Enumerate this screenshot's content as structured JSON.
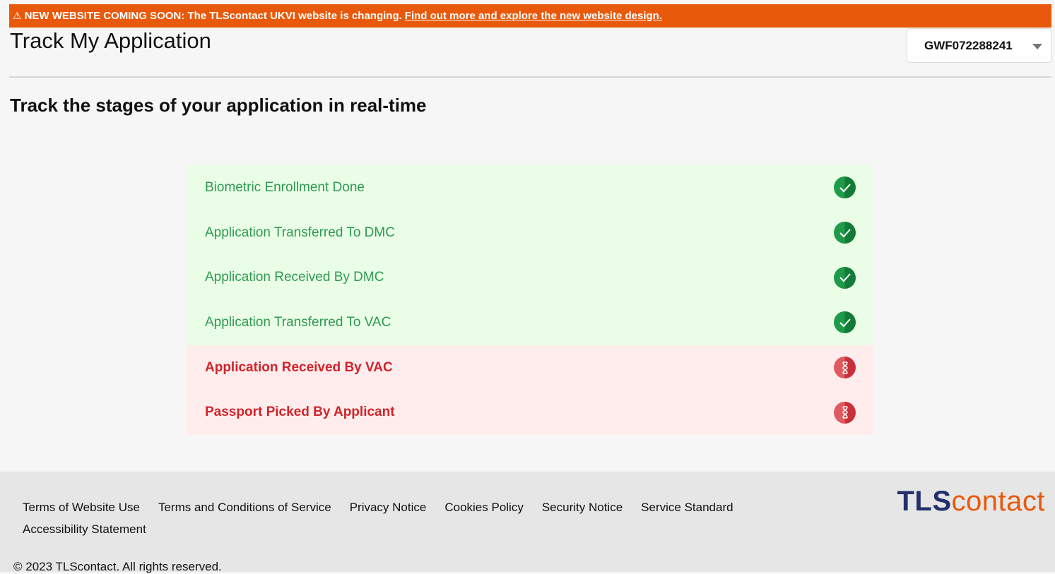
{
  "banner": {
    "headline": "NEW WEBSITE COMING SOON:",
    "message": "The TLScontact UKVI website is changing.",
    "link_text": "Find out more and explore the new website design."
  },
  "header": {
    "title": "Track My Application",
    "application_select": {
      "value": "GWF072288241"
    }
  },
  "main": {
    "subtitle": "Track the stages of your application in real-time",
    "stages": [
      {
        "label": "Biometric Enrollment Done",
        "status": "done",
        "icon": "check-circle-icon"
      },
      {
        "label": "Application Transferred To DMC",
        "status": "done",
        "icon": "check-circle-icon"
      },
      {
        "label": "Application Received By DMC",
        "status": "done",
        "icon": "check-circle-icon"
      },
      {
        "label": "Application Transferred To VAC",
        "status": "done",
        "icon": "check-circle-icon"
      },
      {
        "label": "Application Received By VAC",
        "status": "pending",
        "icon": "hourglass-icon"
      },
      {
        "label": "Passport Picked By Applicant",
        "status": "pending",
        "icon": "hourglass-icon"
      }
    ]
  },
  "footer": {
    "links": [
      "Terms of Website Use",
      "Terms and Conditions of Service",
      "Privacy Notice",
      "Cookies Policy",
      "Security Notice",
      "Service Standard",
      "Accessibility Statement"
    ],
    "logo": {
      "part1": "TLS",
      "part2": "contact"
    },
    "copyright": "© 2023 TLScontact. All rights reserved."
  },
  "colors": {
    "banner": "#e8590c",
    "done_text": "#2e9a52",
    "done_bg": "#eafde6",
    "pending_text": "#d0242b",
    "pending_bg": "#ffeded",
    "brand_navy": "#24306b"
  }
}
